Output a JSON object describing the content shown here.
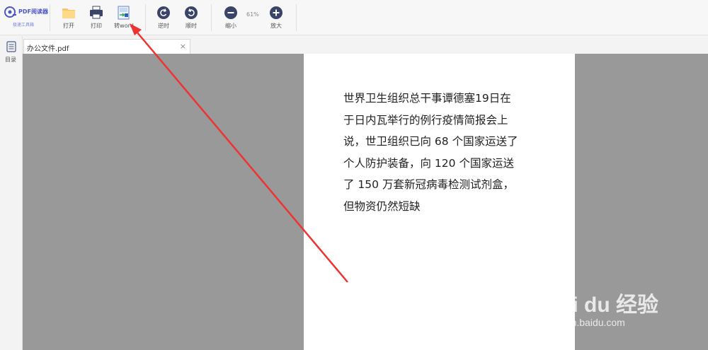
{
  "app": {
    "name": "PDF阅读器",
    "subtitle": "极速工具箱"
  },
  "toolbar": {
    "open_label": "打开",
    "print_label": "打印",
    "to_word_label": "转word",
    "rotate_ccw_label": "逆时",
    "rotate_cw_label": "顺时",
    "zoom_out_label": "缩小",
    "zoom_level": "61%",
    "zoom_in_label": "放大"
  },
  "sidebar": {
    "toc_label": "目录"
  },
  "tab": {
    "filename": "办公文件.pdf",
    "close": "×"
  },
  "document": {
    "lines": [
      "世界卫生组织总干事谭德塞19日在",
      "于日内瓦举行的例行疫情简报会上",
      "说，世卫组织已向 68 个国家运送了",
      "个人防护装备，向 120 个国家运送",
      "了 150 万套新冠病毒检测试剂盒，",
      "但物资仍然短缺"
    ]
  },
  "watermark": {
    "brand": "Bai du 经验",
    "url": "jingyan.baidu.com"
  },
  "colors": {
    "accent": "#4b55c8",
    "icon_dark": "#3a4468",
    "viewer_bg": "#999999",
    "annotation_arrow": "#ee3333"
  }
}
